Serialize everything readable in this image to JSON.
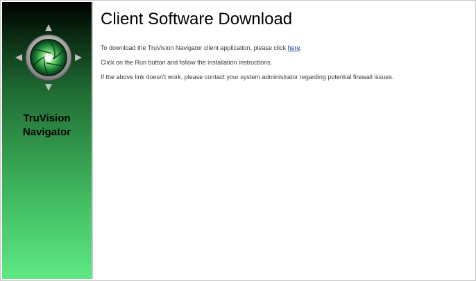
{
  "sidebar": {
    "brand_line1": "TruVision",
    "brand_line2": "Navigator",
    "logo_icon": "truvision-aperture-compass-icon",
    "colors": {
      "top": "#000000",
      "bottom": "#5ee884"
    }
  },
  "main": {
    "title": "Client Software Download",
    "p1_prefix": "To download the TruVision Navigator client application, please click ",
    "p1_link": "here",
    "p1_suffix": ".",
    "p2": "Click on the Run button and follow the installation instructions.",
    "p3": "If the above link doesn't work, please contact your system administrator regarding potential firewall issues.",
    "link_color": "#1a3e9c"
  }
}
